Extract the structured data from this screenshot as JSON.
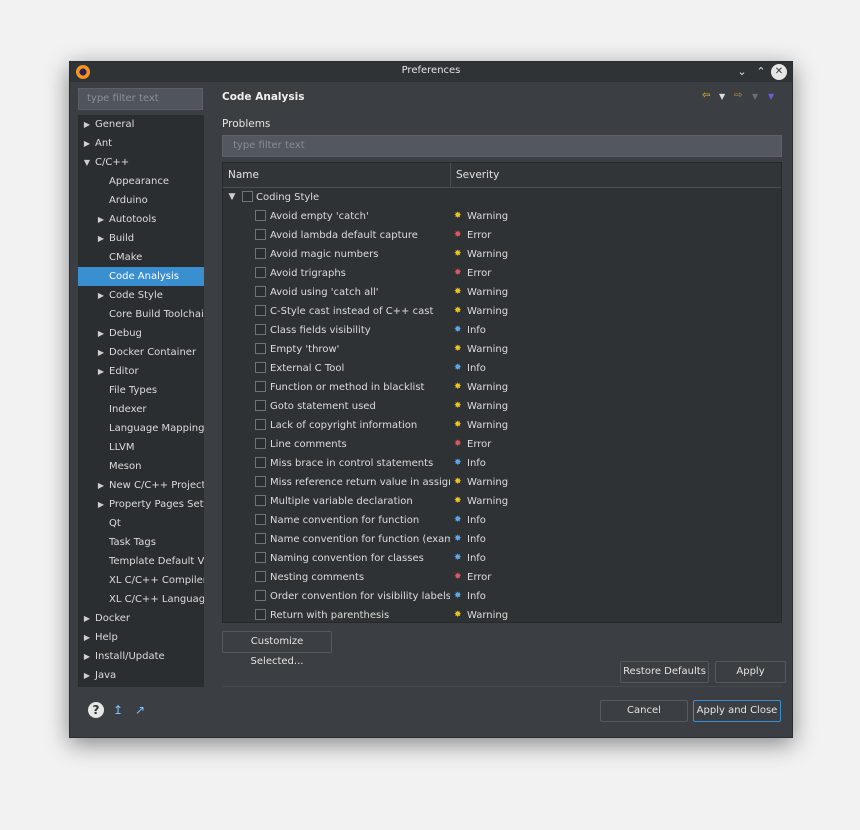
{
  "window": {
    "title": "Preferences"
  },
  "icons": {
    "app": "eclipse-icon",
    "minimize": "chevron-down-icon",
    "maximize": "chevron-up-icon",
    "close": "close-icon"
  },
  "sidebar": {
    "filter_placeholder": "type filter text",
    "items": [
      {
        "label": "General",
        "level": 0,
        "expand": "collapsed"
      },
      {
        "label": "Ant",
        "level": 0,
        "expand": "collapsed"
      },
      {
        "label": "C/C++",
        "level": 0,
        "expand": "expanded"
      },
      {
        "label": "Appearance",
        "level": 1,
        "expand": "none"
      },
      {
        "label": "Arduino",
        "level": 1,
        "expand": "none"
      },
      {
        "label": "Autotools",
        "level": 1,
        "expand": "collapsed"
      },
      {
        "label": "Build",
        "level": 1,
        "expand": "collapsed"
      },
      {
        "label": "CMake",
        "level": 1,
        "expand": "none"
      },
      {
        "label": "Code Analysis",
        "level": 1,
        "expand": "none",
        "selected": true
      },
      {
        "label": "Code Style",
        "level": 1,
        "expand": "collapsed"
      },
      {
        "label": "Core Build Toolchain",
        "level": 1,
        "expand": "none"
      },
      {
        "label": "Debug",
        "level": 1,
        "expand": "collapsed"
      },
      {
        "label": "Docker Container",
        "level": 1,
        "expand": "collapsed"
      },
      {
        "label": "Editor",
        "level": 1,
        "expand": "collapsed"
      },
      {
        "label": "File Types",
        "level": 1,
        "expand": "none"
      },
      {
        "label": "Indexer",
        "level": 1,
        "expand": "none"
      },
      {
        "label": "Language Mappings",
        "level": 1,
        "expand": "none"
      },
      {
        "label": "LLVM",
        "level": 1,
        "expand": "none"
      },
      {
        "label": "Meson",
        "level": 1,
        "expand": "none"
      },
      {
        "label": "New C/C++ Project W",
        "level": 1,
        "expand": "collapsed"
      },
      {
        "label": "Property Pages Setti",
        "level": 1,
        "expand": "collapsed"
      },
      {
        "label": "Qt",
        "level": 1,
        "expand": "none"
      },
      {
        "label": "Task Tags",
        "level": 1,
        "expand": "none"
      },
      {
        "label": "Template Default Va",
        "level": 1,
        "expand": "none"
      },
      {
        "label": "XL C/C++ Compiler",
        "level": 1,
        "expand": "none"
      },
      {
        "label": "XL C/C++ Language",
        "level": 1,
        "expand": "none"
      },
      {
        "label": "Docker",
        "level": 0,
        "expand": "collapsed"
      },
      {
        "label": "Help",
        "level": 0,
        "expand": "collapsed"
      },
      {
        "label": "Install/Update",
        "level": 0,
        "expand": "collapsed"
      },
      {
        "label": "Java",
        "level": 0,
        "expand": "collapsed"
      }
    ],
    "bottom_icons": [
      "help-icon",
      "import-icon",
      "export-icon"
    ]
  },
  "main": {
    "title": "Code Analysis",
    "nav_icons": [
      "back-arrow-icon",
      "back-menu-icon",
      "forward-arrow-icon",
      "forward-menu-icon",
      "view-menu-icon"
    ],
    "problems_label": "Problems",
    "filter_placeholder": "type filter text",
    "columns": [
      "Name",
      "Severity"
    ],
    "group": "Coding Style",
    "rows": [
      {
        "name": "Avoid empty 'catch'",
        "severity": "Warning"
      },
      {
        "name": "Avoid lambda default capture",
        "severity": "Error"
      },
      {
        "name": "Avoid magic numbers",
        "severity": "Warning"
      },
      {
        "name": "Avoid trigraphs",
        "severity": "Error"
      },
      {
        "name": "Avoid using 'catch all'",
        "severity": "Warning"
      },
      {
        "name": "C-Style cast instead of C++ cast",
        "severity": "Warning"
      },
      {
        "name": "Class fields visibility",
        "severity": "Info"
      },
      {
        "name": "Empty 'throw'",
        "severity": "Warning"
      },
      {
        "name": "External C Tool",
        "severity": "Info"
      },
      {
        "name": "Function or method in blacklist",
        "severity": "Warning"
      },
      {
        "name": "Goto statement used",
        "severity": "Warning"
      },
      {
        "name": "Lack of copyright information",
        "severity": "Warning"
      },
      {
        "name": "Line comments",
        "severity": "Error"
      },
      {
        "name": "Miss brace in control statements",
        "severity": "Info"
      },
      {
        "name": "Miss reference return value in assignn",
        "severity": "Warning"
      },
      {
        "name": "Multiple variable declaration",
        "severity": "Warning"
      },
      {
        "name": "Name convention for function",
        "severity": "Info"
      },
      {
        "name": "Name convention for function (exampl",
        "severity": "Info"
      },
      {
        "name": "Naming convention for classes",
        "severity": "Info"
      },
      {
        "name": "Nesting comments",
        "severity": "Error"
      },
      {
        "name": "Order convention for visibility labels",
        "severity": "Info"
      },
      {
        "name": "Return with parenthesis",
        "severity": "Warning"
      }
    ],
    "severity_colors": {
      "Warning": "#f0c419",
      "Error": "#e8545a",
      "Info": "#5aa9f0"
    },
    "customize_label": "Customize Selected...",
    "restore_label": "Restore Defaults",
    "apply_label": "Apply",
    "cancel_label": "Cancel",
    "apply_close_label": "Apply and Close"
  },
  "colors": {
    "accent": "#3a8fd1",
    "background": "#3b3f43"
  }
}
